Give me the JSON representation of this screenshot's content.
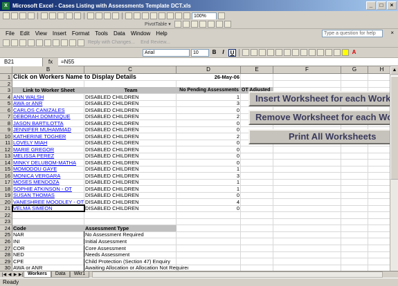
{
  "window": {
    "title": "Microsoft Excel - Cases Listing with Assessments Template DCT.xls"
  },
  "toolbar1": {
    "zoom": "100%"
  },
  "pivot": {
    "label": "PivotTable ▾"
  },
  "menu": [
    "File",
    "Edit",
    "View",
    "Insert",
    "Format",
    "Tools",
    "Data",
    "Window",
    "Help"
  ],
  "help_placeholder": "Type a question for help",
  "reviewbar": {
    "reply": "Reply with Changes...",
    "end": "End Review..."
  },
  "format": {
    "font": "Arial",
    "size": "10"
  },
  "formula_bar": {
    "cell_ref": "B21",
    "fx": "fx",
    "formula": "=N55"
  },
  "columns": [
    "A",
    "B",
    "C",
    "D",
    "E",
    "F",
    "G",
    "H"
  ],
  "rows": [
    "1",
    "2",
    "3",
    "4",
    "5",
    "6",
    "7",
    "8",
    "9",
    "10",
    "11",
    "12",
    "13",
    "14",
    "15",
    "16",
    "17",
    "18",
    "19",
    "20",
    "21",
    "22",
    "23",
    "24",
    "25",
    "26",
    "27",
    "28",
    "29",
    "30"
  ],
  "sheet": {
    "title": "Click on Workers Name to Display Details",
    "date": "26-May-06",
    "headers": {
      "link": "Link to Worker Sheet",
      "team": "Team",
      "pending": "No Pending Assessments",
      "ot": "OT Adjusted"
    },
    "workers": [
      {
        "name": "ANN WALSH",
        "team": "DISABLED CHILDREN",
        "pending": "1"
      },
      {
        "name": "AWA or ANR",
        "team": "DISABLED CHILDREN",
        "pending": "3"
      },
      {
        "name": "CARLOS CANIZALES",
        "team": "DISABLED CHILDREN",
        "pending": "0"
      },
      {
        "name": "DEBORAH DOMINIQUE",
        "team": "DISABLED CHILDREN",
        "pending": "2"
      },
      {
        "name": "JASON BARTILOTTA",
        "team": "DISABLED CHILDREN",
        "pending": "0"
      },
      {
        "name": "JENNIFER MUHAMMAD",
        "team": "DISABLED CHILDREN",
        "pending": "0"
      },
      {
        "name": "KATHERINE TOGHER",
        "team": "DISABLED CHILDREN",
        "pending": "2"
      },
      {
        "name": "LOVELY MIAH",
        "team": "DISABLED CHILDREN",
        "pending": "0"
      },
      {
        "name": "MARIE GREGOR",
        "team": "DISABLED CHILDREN",
        "pending": "0"
      },
      {
        "name": "MELISSA PEREZ",
        "team": "DISABLED CHILDREN",
        "pending": "0"
      },
      {
        "name": "MINKY DELUBOM-MATHA",
        "team": "DISABLED CHILDREN",
        "pending": "0"
      },
      {
        "name": "MOMODOU GAYE",
        "team": "DISABLED CHILDREN",
        "pending": "1"
      },
      {
        "name": "MONICA VERGARA",
        "team": "DISABLED CHILDREN",
        "pending": "3"
      },
      {
        "name": "MOSES MENDOZA",
        "team": "DISABLED CHILDREN",
        "pending": "1"
      },
      {
        "name": "SOPHIE ATKINSON - OT",
        "team": "DISABLED CHILDREN",
        "pending": "1"
      },
      {
        "name": "SUSAN THOMAS",
        "team": "DISABLED CHILDREN",
        "pending": "0"
      },
      {
        "name": "VANESHREE MOODLEY - OT",
        "team": "DISABLED CHILDREN",
        "pending": "4"
      },
      {
        "name": "VELMA SIMEON",
        "team": "DISABLED CHILDREN",
        "pending": "0"
      }
    ],
    "codes_header": {
      "code": "Code",
      "type": "Assessment Type"
    },
    "codes": [
      {
        "code": "NAR",
        "type": "No Assessment Required"
      },
      {
        "code": "INI",
        "type": "Initial Assessment"
      },
      {
        "code": "COR",
        "type": "Core Assessment"
      },
      {
        "code": "NED",
        "type": "Needs Assessment"
      },
      {
        "code": "CPE",
        "type": "Child Protection (Section 47) Enquiry"
      },
      {
        "code": "AWA or ANR",
        "type": "Awaiting Allocation or Allocation Not Required"
      }
    ]
  },
  "buttons": {
    "insert": "Insert Worksheet for each Worker",
    "remove": "Remove Worksheet for each Worker",
    "print": "Print All Worksheets"
  },
  "tabs": [
    "Workers",
    "Data",
    "Wkr1"
  ],
  "status": "Ready"
}
